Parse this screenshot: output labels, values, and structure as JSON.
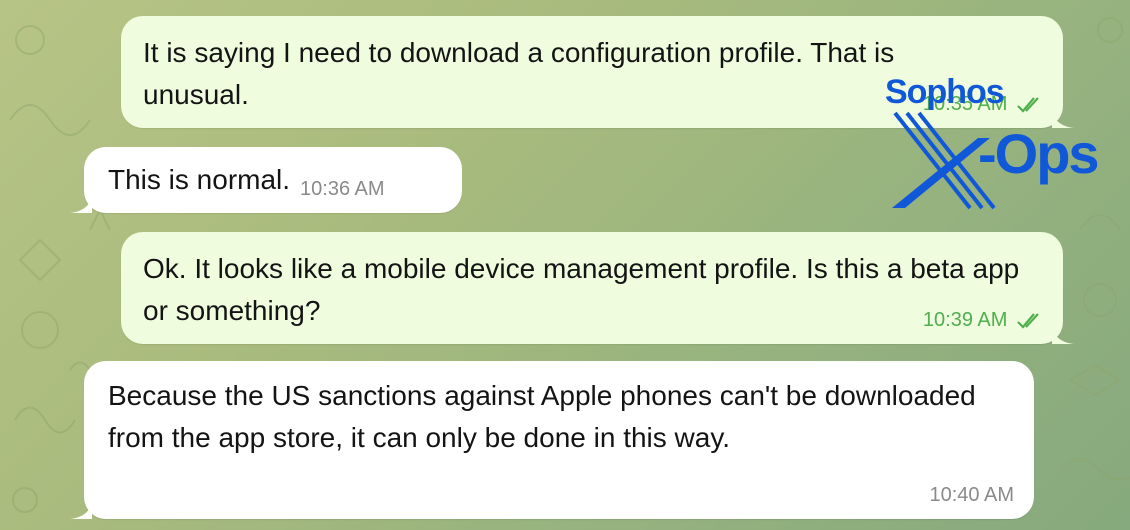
{
  "messages": [
    {
      "direction": "outgoing",
      "text": "It is saying I need to download a configuration profile. That is unusual.",
      "time": "10:35 AM",
      "status": "double-check-read"
    },
    {
      "direction": "incoming",
      "text": "This is normal.",
      "time": "10:36 AM"
    },
    {
      "direction": "outgoing",
      "text": "Ok. It looks like a mobile device management profile. Is this a beta app or something?",
      "time": "10:39 AM",
      "status": "double-check-read"
    },
    {
      "direction": "incoming",
      "text": "Because the US sanctions against Apple phones can't be downloaded from the app store, it can only be done in this way.",
      "time": "10:40 AM"
    }
  ],
  "watermark": {
    "brand": "Sophos",
    "product": "-Ops",
    "mark_letter": "X",
    "color": "#1158d8"
  },
  "colors": {
    "outgoing_bubble": "#effdde",
    "incoming_bubble": "#ffffff",
    "outgoing_time": "#4fae4e",
    "incoming_time": "#8a8a8a"
  }
}
